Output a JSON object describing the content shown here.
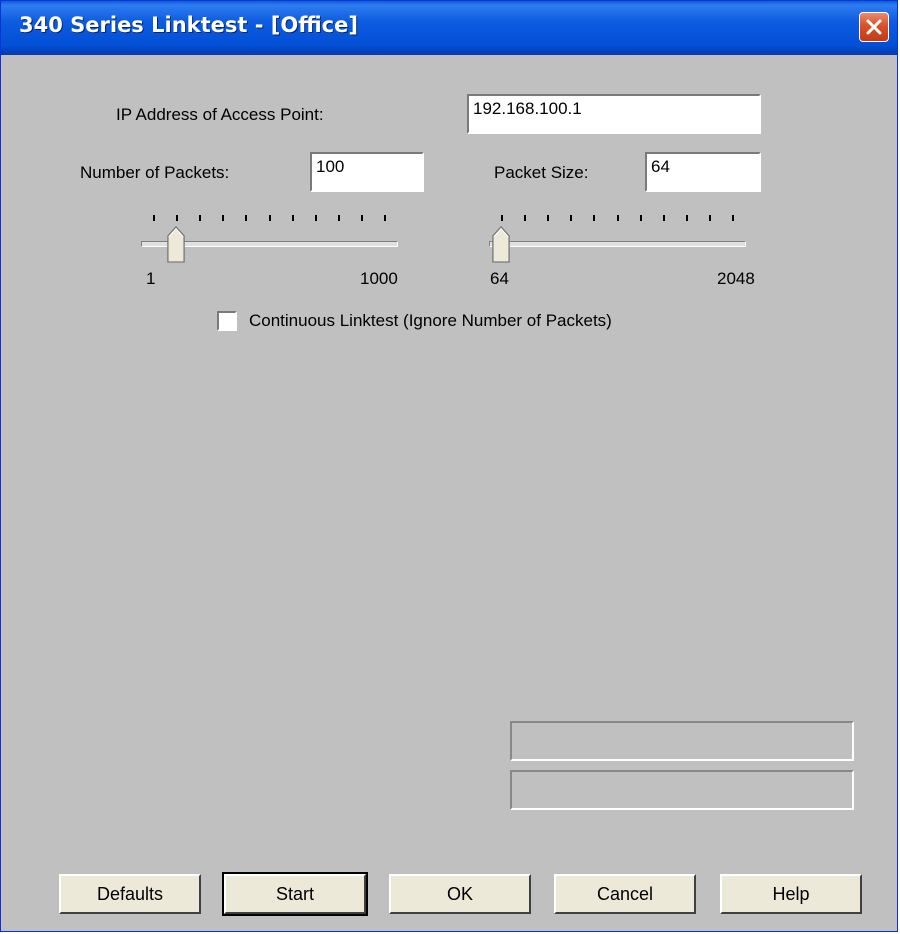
{
  "window": {
    "title": "340 Series Linktest - [Office]"
  },
  "fields": {
    "ip_label": "IP Address of Access Point:",
    "ip_value": "192.168.100.1",
    "packets_label": "Number of Packets:",
    "packets_value": "100",
    "size_label": "Packet Size:",
    "size_value": "64"
  },
  "sliders": {
    "packets": {
      "min_label": "1",
      "max_label": "1000",
      "min": 1,
      "max": 1000,
      "value": 100
    },
    "size": {
      "min_label": "64",
      "max_label": "2048",
      "min": 64,
      "max": 2048,
      "value": 64
    }
  },
  "options": {
    "continuous_label": "Continuous Linktest (Ignore Number of Packets)",
    "continuous_checked": false
  },
  "buttons": {
    "defaults": "Defaults",
    "start": "Start",
    "ok": "OK",
    "cancel": "Cancel",
    "help": "Help"
  },
  "icons": {
    "close": "close-icon"
  }
}
